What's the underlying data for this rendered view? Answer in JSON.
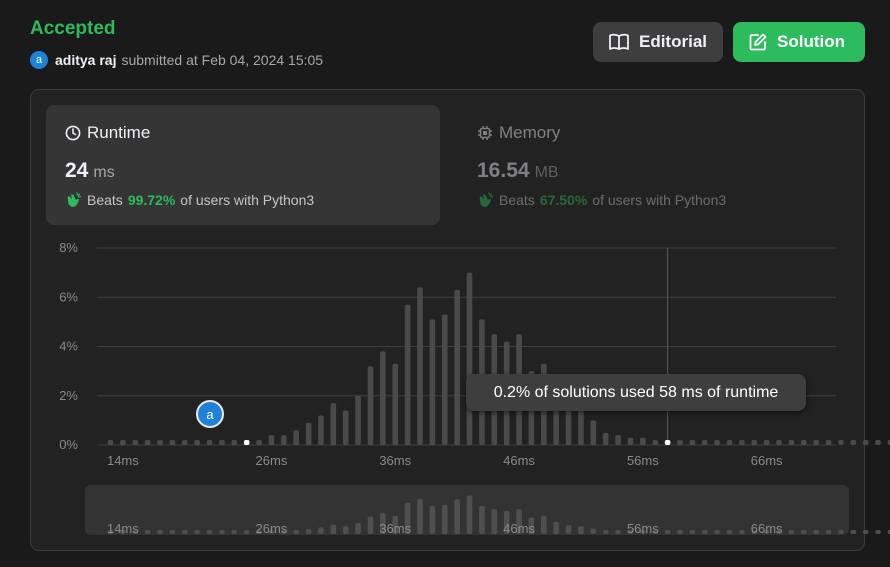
{
  "header": {
    "status": "Accepted",
    "user": {
      "avatar_letter": "a",
      "name": "aditya raj"
    },
    "submitted_text": "submitted at Feb 04, 2024 15:05"
  },
  "buttons": {
    "editorial": "Editorial",
    "solution": "Solution"
  },
  "runtime": {
    "label": "Runtime",
    "value": "24",
    "unit": "ms",
    "beats_prefix": "Beats",
    "beats_pct": "99.72%",
    "beats_suffix": "of users with Python3"
  },
  "memory": {
    "label": "Memory",
    "value": "16.54",
    "unit": "MB",
    "beats_prefix": "Beats",
    "beats_pct": "67.50%",
    "beats_suffix": "of users with Python3"
  },
  "tooltip": "0.2% of solutions used 58 ms of runtime",
  "pin_letter": "a",
  "colors": {
    "accent_green": "#2cbb5d",
    "bar": "#4a4a4a",
    "avatar_blue": "#1d82d8"
  },
  "chart_data": {
    "type": "bar",
    "x": [
      13,
      14,
      15,
      16,
      17,
      18,
      19,
      20,
      21,
      22,
      23,
      24,
      25,
      26,
      27,
      28,
      29,
      30,
      31,
      32,
      33,
      34,
      35,
      36,
      37,
      38,
      39,
      40,
      41,
      42,
      43,
      44,
      45,
      46,
      47,
      48,
      49,
      50,
      51,
      52,
      53,
      54,
      55,
      56,
      57,
      58,
      59,
      60,
      61,
      62,
      63,
      64,
      65,
      66,
      67,
      68,
      69,
      70,
      71,
      72,
      73,
      74,
      75,
      76,
      77,
      78,
      79,
      80
    ],
    "values": [
      0.2,
      0.2,
      0.2,
      0.2,
      0.2,
      0.2,
      0.2,
      0.2,
      0.2,
      0.2,
      0.2,
      0.2,
      0.2,
      0.4,
      0.4,
      0.6,
      0.9,
      1.2,
      1.7,
      1.4,
      2.0,
      3.2,
      3.8,
      3.3,
      5.7,
      6.4,
      5.1,
      5.3,
      6.3,
      7.0,
      5.1,
      4.5,
      4.2,
      4.5,
      3.0,
      3.3,
      2.2,
      1.6,
      1.4,
      1.0,
      0.5,
      0.4,
      0.3,
      0.3,
      0.2,
      0.2,
      0.2,
      0.2,
      0.2,
      0.2,
      0.2,
      0.2,
      0.2,
      0.2,
      0.2,
      0.2,
      0.2,
      0.2,
      0.2,
      0.2,
      0.2,
      0.2,
      0.2,
      0.2,
      0.2,
      0.2,
      0.2,
      0.2
    ],
    "xticks": [
      "14ms",
      "26ms",
      "36ms",
      "46ms",
      "56ms",
      "66ms"
    ],
    "xtick_values": [
      14,
      26,
      36,
      46,
      56,
      66
    ],
    "yticks": [
      "0%",
      "2%",
      "4%",
      "6%",
      "8%"
    ],
    "ytick_values": [
      0,
      2,
      4,
      6,
      8
    ],
    "ylim": [
      0,
      8
    ],
    "xlim": [
      13,
      80
    ],
    "selected_x": 24,
    "hover_x": 58,
    "grid": true
  }
}
